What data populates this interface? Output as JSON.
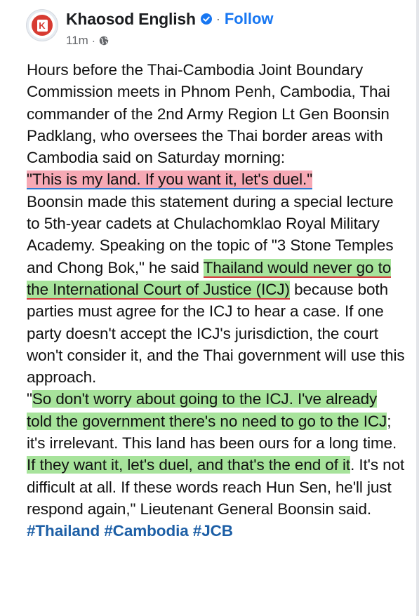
{
  "header": {
    "page_name": "Khaosod English",
    "follow_label": "Follow",
    "time": "11m",
    "separator": "·",
    "avatar_letter": "K",
    "icons": {
      "verified": "verified-badge-icon",
      "audience": "globe-icon"
    }
  },
  "post": {
    "intro": "Hours before the Thai-Cambodia Joint Boundary Commission meets in Phnom Penh, Cambodia, Thai commander of the 2nd Army Region Lt Gen Boonsin Padklang, who oversees the Thai border areas with Cambodia said on Saturday morning:",
    "quote1": "\"This is my land. If you want it, let's duel.\"",
    "para2_a": "Boonsin made this statement during a special lecture to 5th-year cadets at Chulachomklao Royal Military Academy. Speaking on the topic of \"3 Stone Temples and Chong Bok,\" he said ",
    "para2_hl": "Thailand would never go to the International Court of Justice (ICJ)",
    "para2_b": " because both parties must agree for the ICJ to hear a case. If one party doesn't accept the ICJ's jurisdiction, the court won't consider it, and the Thai government will use this approach.",
    "para3_q": "\"",
    "para3_hl1": "So don't worry about going to the ICJ. I've already told the government there's no need to go to the ICJ",
    "para3_a": "; it's irrelevant. This land has been ours for a long time. ",
    "para3_hl2": "If they want it, let's duel, and that's the end of it",
    "para3_b": ". It's not difficult at all. If these words reach Hun Sen, he'll just respond again,\" Lieutenant General Boonsin said.",
    "hashtags": "#Thailand #Cambodia #JCB"
  },
  "colors": {
    "accent": "#1877f2",
    "highlight_pink": "#f6a9b5",
    "highlight_green": "#a7e39b",
    "hashtag": "#1d5fa6",
    "brand_red": "#d73b32"
  }
}
